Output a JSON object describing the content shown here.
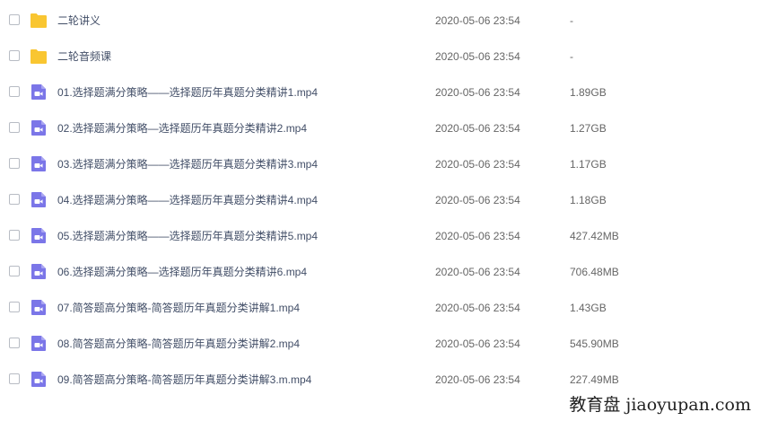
{
  "files": [
    {
      "type": "folder",
      "name": "二轮讲义",
      "date": "2020-05-06 23:54",
      "size": "-"
    },
    {
      "type": "folder",
      "name": "二轮音频课",
      "date": "2020-05-06 23:54",
      "size": "-"
    },
    {
      "type": "video",
      "name": "01.选择题满分策略——选择题历年真题分类精讲1.mp4",
      "date": "2020-05-06 23:54",
      "size": "1.89GB"
    },
    {
      "type": "video",
      "name": "02.选择题满分策略—选择题历年真题分类精讲2.mp4",
      "date": "2020-05-06 23:54",
      "size": "1.27GB"
    },
    {
      "type": "video",
      "name": "03.选择题满分策略——选择题历年真题分类精讲3.mp4",
      "date": "2020-05-06 23:54",
      "size": "1.17GB"
    },
    {
      "type": "video",
      "name": "04.选择题满分策略——选择题历年真题分类精讲4.mp4",
      "date": "2020-05-06 23:54",
      "size": "1.18GB"
    },
    {
      "type": "video",
      "name": "05.选择题满分策略——选择题历年真题分类精讲5.mp4",
      "date": "2020-05-06 23:54",
      "size": "427.42MB"
    },
    {
      "type": "video",
      "name": "06.选择题满分策略—选择题历年真题分类精讲6.mp4",
      "date": "2020-05-06 23:54",
      "size": "706.48MB"
    },
    {
      "type": "video",
      "name": "07.简答题高分策略-简答题历年真题分类讲解1.mp4",
      "date": "2020-05-06 23:54",
      "size": "1.43GB"
    },
    {
      "type": "video",
      "name": "08.简答题高分策略-简答题历年真题分类讲解2.mp4",
      "date": "2020-05-06 23:54",
      "size": "545.90MB"
    },
    {
      "type": "video",
      "name": "09.简答题高分策略-简答题历年真题分类讲解3.m.mp4",
      "date": "2020-05-06 23:54",
      "size": "227.49MB"
    }
  ],
  "icons": {
    "folder": "folder-icon",
    "video": "video-file-icon"
  },
  "colors": {
    "folder": "#f9c531",
    "video": "#7b76e8",
    "name_text": "#424e67"
  },
  "watermark": "教育盘 jiaoyupan.com"
}
